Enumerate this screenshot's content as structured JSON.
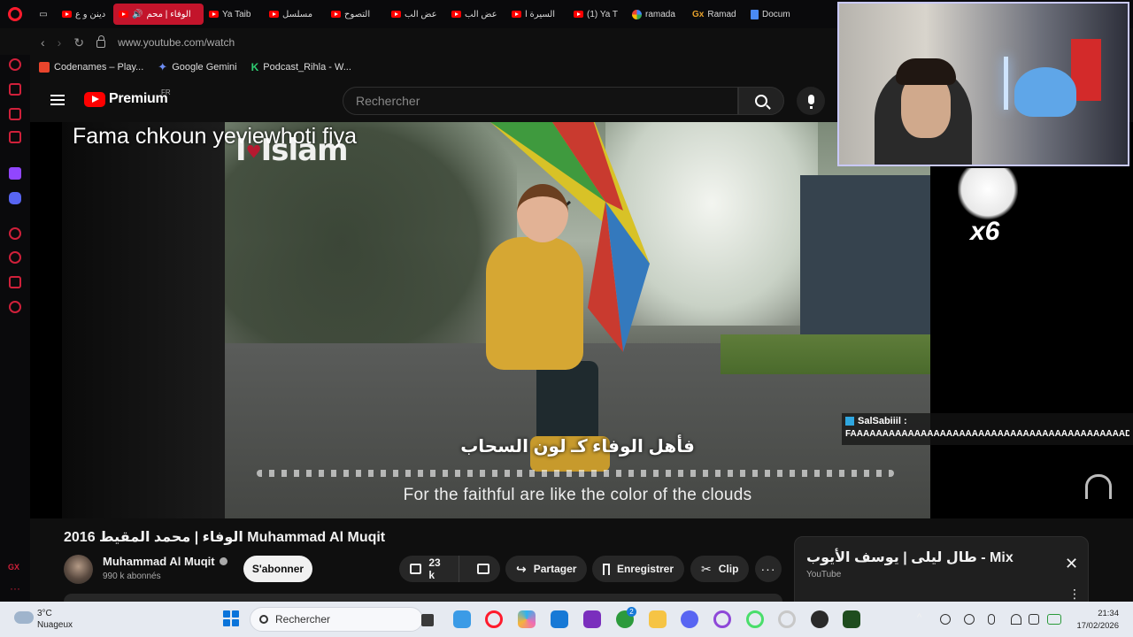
{
  "browser": {
    "tabs": [
      {
        "label": "دينن و ع",
        "icon": "youtube-icon"
      },
      {
        "label": "الوفاء | محم",
        "icon": "youtube-icon",
        "active": true
      },
      {
        "label": "Ya Taib",
        "icon": "youtube-icon"
      },
      {
        "label": "مسلسل",
        "icon": "youtube-icon"
      },
      {
        "label": "التصوح",
        "icon": "youtube-icon"
      },
      {
        "label": "عض الب",
        "icon": "youtube-icon"
      },
      {
        "label": "عض الب",
        "icon": "youtube-icon"
      },
      {
        "label": "السيرة ا",
        "icon": "youtube-icon"
      },
      {
        "label": "(1) Ya T",
        "icon": "youtube-icon"
      },
      {
        "label": "ramada",
        "icon": "google-icon"
      },
      {
        "label": "Ramad",
        "icon": "gx-icon"
      },
      {
        "label": "Docum",
        "icon": "docs-icon"
      }
    ],
    "url": "www.youtube.com/watch",
    "bookmarks": [
      {
        "label": "Codenames – Play...",
        "color": "#e9452c"
      },
      {
        "label": "Google Gemini",
        "color": "#6d8cf2"
      },
      {
        "label": "Podcast_Rihla - W...",
        "color": "#2ecc71"
      }
    ]
  },
  "youtube": {
    "logo_text": "Premium",
    "region": "FR",
    "search_placeholder": "Rechercher"
  },
  "video": {
    "overlay_title": "Fama chkoun yeviewhoti fiya",
    "channel_watermark": "Islam",
    "arabic_subtitle": "فأهل الوفاء كـ لون السحاب",
    "english_subtitle": "For the faithful are like the color of the clouds",
    "title": "الوفاء | محمد المقيط 2016 Muhammad Al Muqit",
    "channel_name": "Muhammad Al Muqit",
    "subscribers": "990 k abonnés",
    "subscribe_label": "S'abonner",
    "likes": "23 k",
    "share_label": "Partager",
    "save_label": "Enregistrer",
    "clip_label": "Clip"
  },
  "stream_overlay": {
    "combo": "x6",
    "chat_user": "SalSabiiil :",
    "chat_message": "FAAAAAAAAAAAAAAAAAAAAAAAAAAAAAAAAAAAAAAAAAAADIIIIIIIT"
  },
  "mix_card": {
    "title": "طال ليلى | يوسف الأيوب - Mix",
    "subtitle": "YouTube"
  },
  "taskbar": {
    "temperature": "3°C",
    "weather": "Nuageux",
    "search_label": "Rechercher",
    "time": "21:34",
    "date": "17/02/2026",
    "badge_count": "2"
  },
  "colors": {
    "opera_red": "#ff1b2d",
    "youtube_red": "#ff0000",
    "active_tab": "#c3142b"
  }
}
